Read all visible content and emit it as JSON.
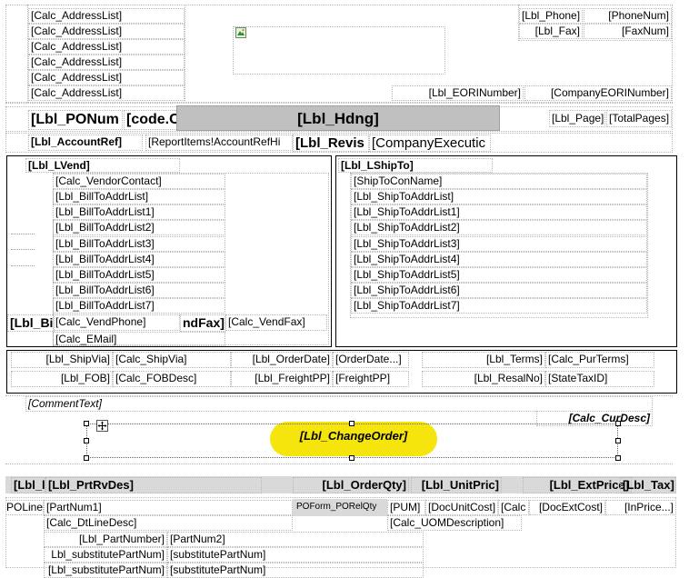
{
  "header": {
    "address_list": [
      "[Calc_AddressList]",
      "[Calc_AddressList]",
      "[Calc_AddressList]",
      "[Calc_AddressList]",
      "[Calc_AddressList]",
      "[Calc_AddressList]"
    ],
    "lbl_phone": "[Lbl_Phone]",
    "phone_num": "[PhoneNum]",
    "lbl_fax": "[Lbl_Fax]",
    "fax_num": "[FaxNum]",
    "lbl_eori": "[Lbl_EORINumber]",
    "company_eori": "[CompanyEORINumber]",
    "lbl_ponum": "[Lbl_PONum",
    "code": "[code.C",
    "lbl_hdng": "[Lbl_Hdng]",
    "lbl_page": "[Lbl_Page]",
    "total_pages": "[TotalPages]",
    "lbl_accountref": "[Lbl_AccountRef]",
    "report_items": "[ReportItems!AccountRefHi",
    "lbl_revis": "[Lbl_Revis",
    "company_exec": "[CompanyExecutic"
  },
  "vendor": {
    "lbl_lvend": "[Lbl_LVend]",
    "fields": [
      "[Calc_VendorContact]",
      "[Lbl_BillToAddrList]",
      "[Lbl_BillToAddrList1]",
      "[Lbl_BillToAddrList2]",
      "[Lbl_BillToAddrList3]",
      "[Lbl_BillToAddrList4]",
      "[Lbl_BillToAddrList5]",
      "[Lbl_BillToAddrList6]",
      "[Lbl_BillToAddrList7]"
    ],
    "lbl_bi": "[Lbl_Bi",
    "vend_phone": "[Calc_VendPhone]",
    "nd_fax": "ndFax]",
    "vend_fax": "[Calc_VendFax]",
    "email": "[Calc_EMail]"
  },
  "shipto": {
    "lbl_lshipto": "[Lbl_LShipTo]",
    "fields": [
      "[ShipToConName]",
      "[Lbl_ShipToAddrList]",
      "[Lbl_ShipToAddrList1]",
      "[Lbl_ShipToAddrList2]",
      "[Lbl_ShipToAddrList3]",
      "[Lbl_ShipToAddrList4]",
      "[Lbl_ShipToAddrList5]",
      "[Lbl_ShipToAddrList6]",
      "[Lbl_ShipToAddrList7]"
    ]
  },
  "terms": {
    "lbl_shipvia": "[Lbl_ShipVia]",
    "calc_shipvia": "[Calc_ShipVia]",
    "lbl_orderdate": "[Lbl_OrderDate]",
    "orderdate": "[OrderDate...]",
    "lbl_terms": "[Lbl_Terms]",
    "calc_purterms": "[Calc_PurTerms]",
    "lbl_fob": "[Lbl_FOB]",
    "calc_fobdesc": "[Calc_FOBDesc]",
    "lbl_freightpp": "[Lbl_FreightPP]",
    "freightpp": "[FreightPP]",
    "lbl_resalno": "[Lbl_ResalNo]",
    "statetaxid": "[StateTaxID]"
  },
  "comments": {
    "comment_text": "[CommentText]",
    "calc_curdesc": "[Calc_CurDesc]",
    "change_order": "[Lbl_ChangeOrder]"
  },
  "lines": {
    "headers": [
      "[Lbl_l",
      "[Lbl_PrtRvDes]",
      "[Lbl_OrderQty]",
      "[Lbl_UnitPric]",
      "[Lbl_ExtPrice]",
      "[Lbl_Tax]"
    ],
    "poline": "POLine",
    "partnum1": "[PartNum1]",
    "relqty": "POForm_PORelQty",
    "pum": "[PUM]",
    "docunitcost": "[DocUnitCost]",
    "calc_short": "[Calc",
    "docextcost": "[DocExtCost]",
    "inprice": "[InPrice...]",
    "dtlinedesc": "[Calc_DtLineDesc]",
    "uomdesc": "[Calc_UOMDescription]",
    "lbl_partnumber": "[Lbl_PartNumber]",
    "partnum2": "[PartNum2]",
    "lbl_substitute": "Lbl_substitutePartNum]",
    "substitute": "[substitutePartNum]",
    "lbl_bottom": "[Lbl_substitutePartNum]",
    "bottom_partial": "[substitutePartNum]"
  },
  "colors": {
    "highlight": "#f5e50d",
    "band_gray": "#c0c0c0",
    "icon_green": "#2e8b3a"
  }
}
